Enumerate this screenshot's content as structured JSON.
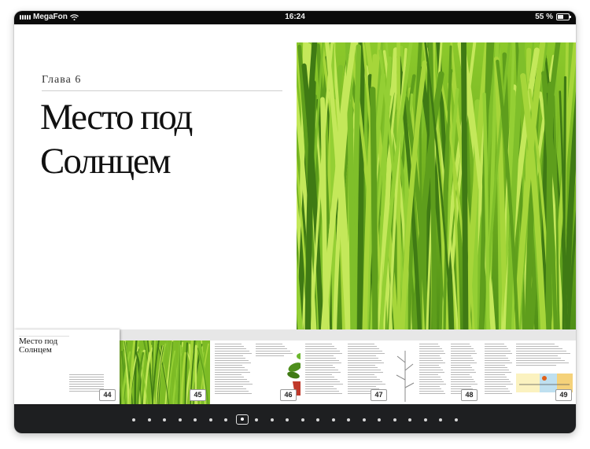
{
  "status_bar": {
    "carrier": "MegaFon",
    "time": "16:24",
    "battery": "55 %",
    "battery_level": 0.55
  },
  "page": {
    "chapter_label": "Глава 6",
    "chapter_title": "Место под\nСолнцем"
  },
  "thumbnails": [
    {
      "page_number": "44",
      "mini_title": "Место под\nСолнцем"
    },
    {
      "page_number": "45"
    },
    {
      "page_number": "46"
    },
    {
      "page_number": "47"
    },
    {
      "page_number": "48"
    },
    {
      "page_number": "49"
    }
  ],
  "navigation": {
    "dot_count": 22,
    "current_index": 7
  },
  "colors": {
    "status_bar_bg": "#0b0b0b",
    "nav_bar_bg": "#1e1f21",
    "grass_light": "#a6d63a",
    "grass_dark": "#3f7a14"
  }
}
